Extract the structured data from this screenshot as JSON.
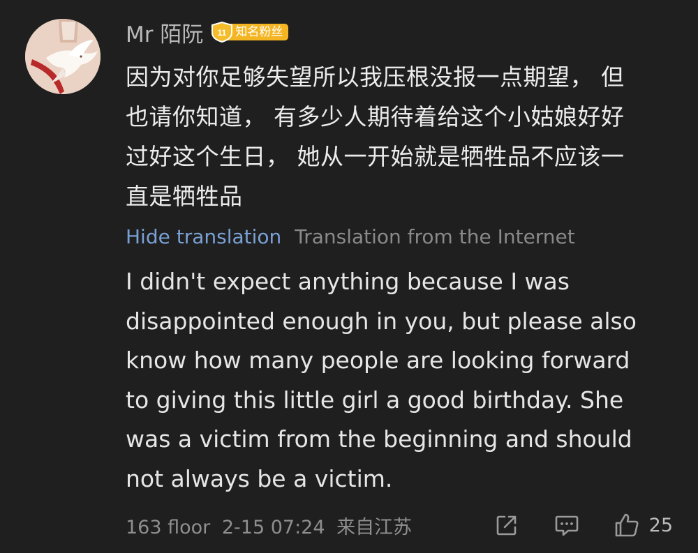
{
  "user": {
    "name": "Mr 陌阮",
    "badge_level": "11",
    "badge_text": "知名粉丝"
  },
  "comment": {
    "original_lines": [
      "因为对你足够失望所以我压根没报一点期望， 但",
      "也请你知道， 有多少人期待着给这个小姑娘好好",
      "过好这个生日， 她从一开始就是牺牲品不应该一",
      "直是牺牲品"
    ],
    "hide_translation_label": "Hide translation",
    "translation_source": "Translation from the Internet",
    "translation_lines": [
      "I didn't expect anything because I was",
      "disappointed enough in you, but please also",
      "know how many people are looking forward",
      "to giving this little girl a good birthday. She",
      "was a victim from the beginning and should",
      "not always be a victim."
    ]
  },
  "footer": {
    "floor": "163 floor",
    "time": "2-15 07:24",
    "location": "来自江苏",
    "likes": "25"
  },
  "icons": {
    "share": "share-icon",
    "reply": "comment-icon",
    "like": "thumbs-up-icon"
  },
  "colors": {
    "background": "#1f1f1f",
    "link": "#7aa1d6",
    "badge": "#f4b522"
  }
}
